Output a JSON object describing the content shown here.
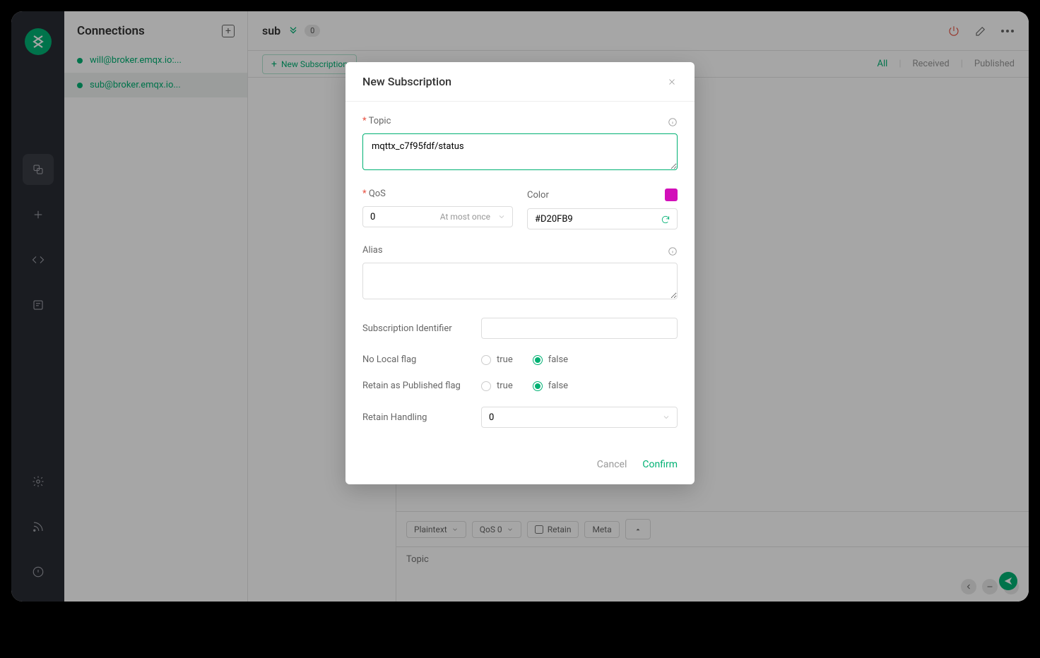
{
  "sidebar_title": "Connections",
  "connections": [
    {
      "name": "will@broker.emqx.io:..."
    },
    {
      "name": "sub@broker.emqx.io..."
    }
  ],
  "main": {
    "title": "sub",
    "badge": "0",
    "new_sub_btn": "New Subscription",
    "tabs": {
      "all": "All",
      "received": "Received",
      "published": "Published"
    }
  },
  "footer": {
    "payload": "Plaintext",
    "qos": "QoS 0",
    "retain": "Retain",
    "meta": "Meta",
    "topic_placeholder": "Topic"
  },
  "modal": {
    "title": "New Subscription",
    "topic_label": "Topic",
    "topic_value": "mqttx_c7f95fdf/status",
    "qos_label": "QoS",
    "qos_value": "0",
    "qos_hint": "At most once",
    "color_label": "Color",
    "color_value": "#D20FB9",
    "alias_label": "Alias",
    "alias_value": "",
    "sub_id_label": "Subscription Identifier",
    "sub_id_value": "",
    "no_local_label": "No Local flag",
    "retain_pub_label": "Retain as Published flag",
    "retain_handling_label": "Retain Handling",
    "retain_handling_value": "0",
    "true_label": "true",
    "false_label": "false",
    "cancel": "Cancel",
    "confirm": "Confirm"
  }
}
